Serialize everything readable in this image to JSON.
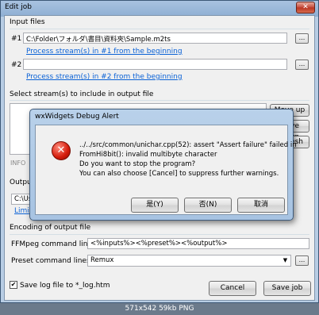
{
  "window": {
    "title": "Edit job",
    "close_glyph": "✕"
  },
  "input_files": {
    "section_label": "Input files",
    "file1": {
      "label": "#1",
      "value": "C:\\Folder\\フォルダ\\書目\\資料夾\\Sample.m2ts",
      "browse": "...",
      "link": "Process stream(s) in #1 from the beginning"
    },
    "file2": {
      "label": "#2",
      "value": "",
      "browse": "...",
      "link": "Process stream(s) in #2 from the beginning"
    }
  },
  "streams": {
    "section_label": "Select stream(s) to include in output file",
    "move_up": "Move up",
    "move_down": "Move down",
    "refresh": "Refresh",
    "info_label": "INFO"
  },
  "output": {
    "section_label": "Output",
    "path_value": "C:\\Us",
    "limit_link": "Limit"
  },
  "encoding": {
    "section_label": "Encoding of output file",
    "ffmpeg_label": "FFMpeg command line",
    "ffmpeg_value": "<%inputs%><%preset%><%output%>",
    "preset_label": "Preset command lines",
    "preset_value": "Remux",
    "browse": "..."
  },
  "footer": {
    "save_log_label": "Save log file to *_log.htm",
    "save_log_checked": true,
    "cancel": "Cancel",
    "save_job": "Save job"
  },
  "dialog": {
    "title": "wxWidgets Debug Alert",
    "icon": "error-icon",
    "lines": [
      "../../src/common/unichar.cpp(52): assert \"Assert failure\" failed in",
      "FromHi8bit(): invalid multibyte character",
      "Do you want to stop the program?",
      "You can also choose [Cancel] to suppress further warnings."
    ],
    "yes": "是(Y)",
    "no": "否(N)",
    "cancel": "取消"
  },
  "caption": "571x542 59kb PNG"
}
